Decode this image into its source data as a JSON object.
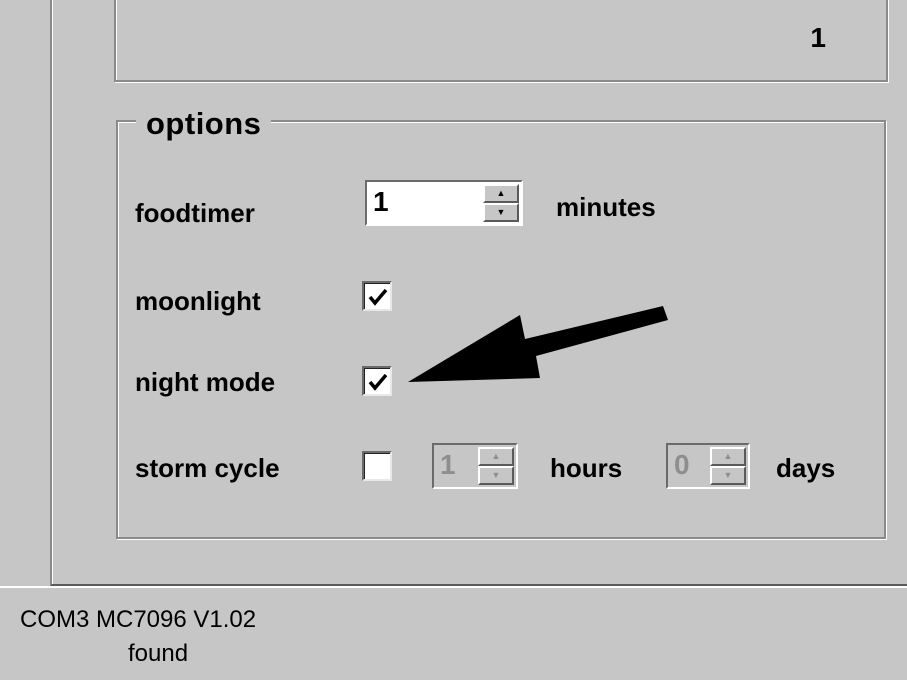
{
  "top_panel": {
    "value": "1"
  },
  "options": {
    "title": "options",
    "foodtimer": {
      "label": "foodtimer",
      "value": "1",
      "unit": "minutes",
      "up_icon": "spin-up-arrow",
      "down_icon": "spin-down-arrow"
    },
    "moonlight": {
      "label": "moonlight",
      "checked": true
    },
    "night_mode": {
      "label": "night mode",
      "checked": true
    },
    "storm_cycle": {
      "label": "storm cycle",
      "checked": false,
      "hours_value": "1",
      "hours_unit": "hours",
      "days_value": "0",
      "days_unit": "days",
      "disabled": true
    }
  },
  "annotation": {
    "icon": "pointer-arrow",
    "color": "#000000"
  },
  "status": {
    "line1": "COM3 MC7096 V1.02",
    "line2": "found"
  },
  "colors": {
    "background": "#c6c6c6",
    "text": "#000000",
    "disabled_text": "#8e8e8e"
  }
}
